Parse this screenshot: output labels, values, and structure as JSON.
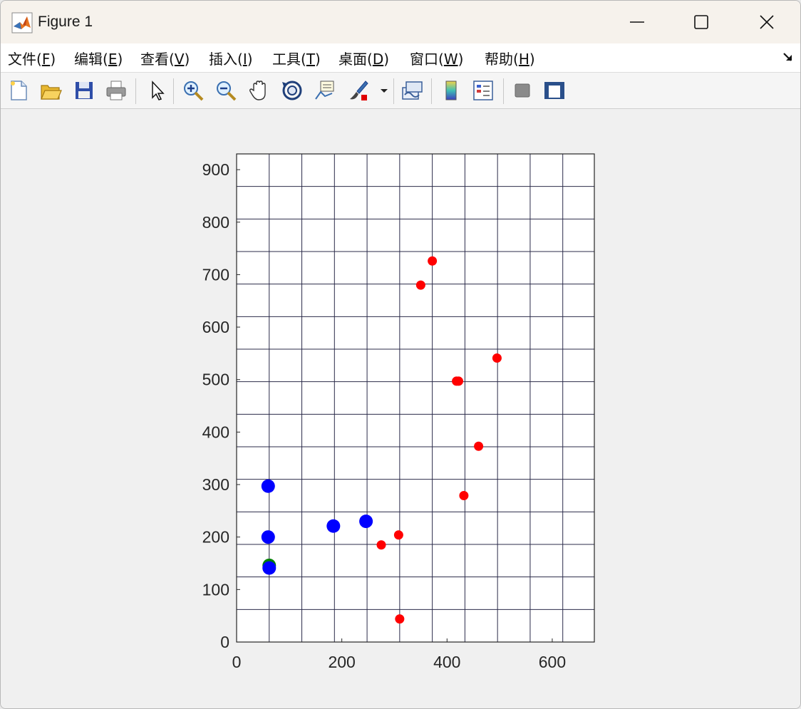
{
  "window": {
    "title": "Figure 1",
    "icon": "matlab-logo-icon"
  },
  "menu": {
    "items": [
      {
        "pre": "文件(",
        "key": "F",
        "post": ")"
      },
      {
        "pre": "编辑(",
        "key": "E",
        "post": ")"
      },
      {
        "pre": "查看(",
        "key": "V",
        "post": ")"
      },
      {
        "pre": "插入(",
        "key": "I",
        "post": ")"
      },
      {
        "pre": "工具(",
        "key": "T",
        "post": ")"
      },
      {
        "pre": "桌面(",
        "key": "D",
        "post": ")"
      },
      {
        "pre": "窗口(",
        "key": "W",
        "post": ")"
      },
      {
        "pre": "帮助(",
        "key": "H",
        "post": ")"
      }
    ]
  },
  "toolbar": {
    "icons": [
      "new-figure-icon",
      "open-file-icon",
      "save-icon",
      "print-icon",
      "edit-plot-pointer-icon",
      "zoom-in-icon",
      "zoom-out-icon",
      "pan-hand-icon",
      "rotate-3d-icon",
      "data-cursor-icon",
      "brush-icon",
      "brush-dropdown-icon",
      "link-plot-icon",
      "insert-colorbar-icon",
      "insert-legend-icon",
      "hide-plot-tools-icon",
      "show-plot-tools-icon"
    ]
  },
  "chart_data": {
    "type": "scatter",
    "title": "",
    "xlabel": "",
    "ylabel": "",
    "xlim": [
      0,
      680
    ],
    "ylim": [
      0,
      930
    ],
    "grid": true,
    "xticks": [
      0,
      200,
      400,
      600
    ],
    "yticks": [
      0,
      100,
      200,
      300,
      400,
      500,
      600,
      700,
      800,
      900
    ],
    "grid_x": [
      0,
      62,
      124,
      186,
      248,
      310,
      372,
      434,
      496,
      558,
      620,
      680
    ],
    "grid_y": [
      0,
      62,
      124,
      186,
      248,
      310,
      372,
      434,
      496,
      558,
      620,
      682,
      744,
      806,
      868,
      930
    ],
    "series": [
      {
        "color": "#ff0000",
        "marker_size": "small",
        "points": [
          [
            372,
            726
          ],
          [
            350,
            680
          ],
          [
            418,
            497
          ],
          [
            422,
            497
          ],
          [
            495,
            541
          ],
          [
            460,
            373
          ],
          [
            432,
            279
          ],
          [
            308,
            204
          ],
          [
            275,
            185
          ],
          [
            310,
            44
          ]
        ]
      },
      {
        "color": "#008000",
        "marker_size": "large",
        "points": [
          [
            62,
            146
          ]
        ]
      },
      {
        "color": "#0000ff",
        "marker_size": "large",
        "points": [
          [
            60,
            297
          ],
          [
            60,
            200
          ],
          [
            62,
            141
          ],
          [
            184,
            221
          ],
          [
            246,
            230
          ]
        ]
      }
    ]
  }
}
